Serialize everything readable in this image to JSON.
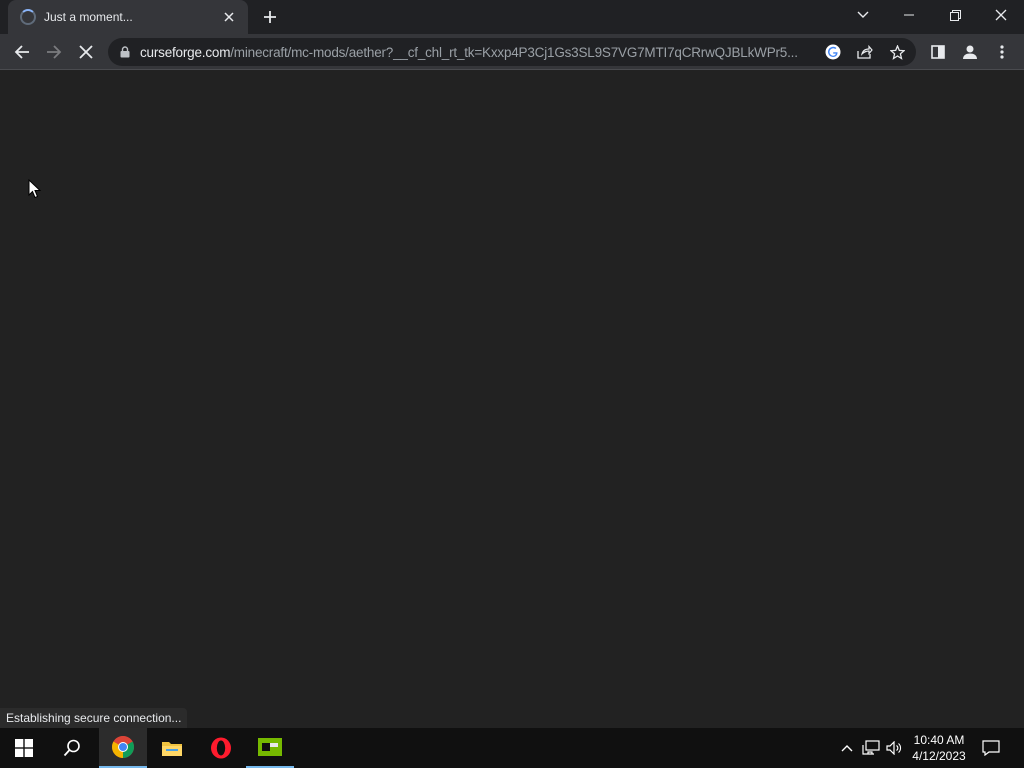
{
  "browser": {
    "tab": {
      "title": "Just a moment..."
    },
    "address": {
      "host": "curseforge.com",
      "path": "/minecraft/mc-mods/aether?__cf_chl_rt_tk=Kxxp4P3Cj1Gs3SL9S7VG7MTI7qCRrwQJBLkWPr5..."
    },
    "status_text": "Establishing secure connection..."
  },
  "taskbar": {
    "time": "10:40 AM",
    "date": "4/12/2023",
    "apps": [
      "chrome-icon",
      "file-explorer-icon",
      "opera-icon",
      "nvidia-icon"
    ]
  },
  "colors": {
    "page_bg": "#222222",
    "toolbar_bg": "#35363a",
    "tabstrip_bg": "#202124",
    "taskbar_bg": "#101010",
    "accent": "#8ab4f8"
  }
}
